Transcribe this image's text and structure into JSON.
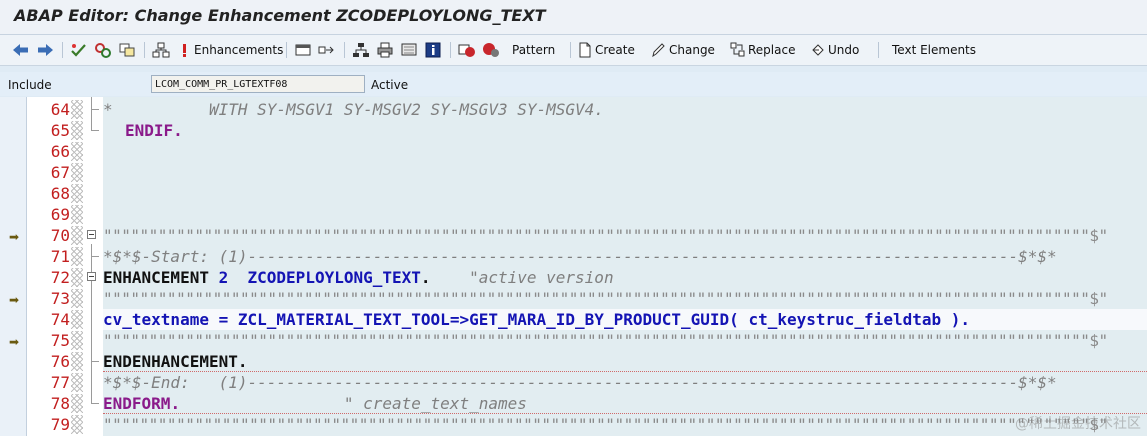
{
  "window": {
    "title": "ABAP Editor: Change Enhancement ZCODEPLOYLONG_TEXT"
  },
  "toolbar": {
    "back_icon": "arrow-left",
    "forward_icon": "arrow-right",
    "enhancements_label": "Enhancements",
    "pattern_label": "Pattern",
    "create_label": "Create",
    "change_label": "Change",
    "replace_label": "Replace",
    "undo_label": "Undo",
    "text_elements_label": "Text Elements"
  },
  "include": {
    "label": "Include",
    "value": "LCOM_COMM_PR_LGTEXTF08",
    "status": "Active"
  },
  "editor": {
    "lines": [
      {
        "num": "64",
        "code": "*          WITH SY-MSGV1 SY-MSGV2 SY-MSGV3 SY-MSGV4."
      },
      {
        "num": "65",
        "code": "ENDIF."
      },
      {
        "num": "66",
        "code": ""
      },
      {
        "num": "67",
        "code": ""
      },
      {
        "num": "68",
        "code": ""
      },
      {
        "num": "69",
        "code": ""
      },
      {
        "num": "70",
        "code": "\"\"\"\"\"\"\"\"\"\"\"\"\"\"\"\"\"\"\"\"\"\"\"\"\"\"\"\"\"\"\"\"\"\"\"\"\"\"\"\"\"\"\"\"\"\"\"\"\"\"\"\"\"\"\"\"\"\"\"\"\"\"\"\"\"\"\"\"\"\"\"\"\"\"\"\"\"\"\"\"\"\"\"\"\"\"\"\"\"\"\"\"\"\"\"\"\"\"\"\"\"\"\"\"\"\"\"\"$\""
      },
      {
        "num": "71",
        "code": "*$*$-Start: (1)--------------------------------------------------------------------------------$*$*"
      },
      {
        "num": "72",
        "kw1": "ENHANCEMENT",
        "num_lit": "2",
        "name": "ZCODEPLOYLONG_TEXT",
        "dot": ".",
        "comment": "\"active version"
      },
      {
        "num": "73",
        "code": "\"\"\"\"\"\"\"\"\"\"\"\"\"\"\"\"\"\"\"\"\"\"\"\"\"\"\"\"\"\"\"\"\"\"\"\"\"\"\"\"\"\"\"\"\"\"\"\"\"\"\"\"\"\"\"\"\"\"\"\"\"\"\"\"\"\"\"\"\"\"\"\"\"\"\"\"\"\"\"\"\"\"\"\"\"\"\"\"\"\"\"\"\"\"\"\"\"\"\"\"\"\"\"\"\"\"\"\"$\""
      },
      {
        "num": "74",
        "var1": "cv_textname",
        "eq": "=",
        "cls": "ZCL_MATERIAL_TEXT_TOOL",
        "arrow": "=>",
        "meth": "GET_MARA_ID_BY_PRODUCT_GUID",
        "open": "(",
        "arg": "ct_keystruc_fieldtab",
        "close": ")."
      },
      {
        "num": "75",
        "code": "\"\"\"\"\"\"\"\"\"\"\"\"\"\"\"\"\"\"\"\"\"\"\"\"\"\"\"\"\"\"\"\"\"\"\"\"\"\"\"\"\"\"\"\"\"\"\"\"\"\"\"\"\"\"\"\"\"\"\"\"\"\"\"\"\"\"\"\"\"\"\"\"\"\"\"\"\"\"\"\"\"\"\"\"\"\"\"\"\"\"\"\"\"\"\"\"\"\"\"\"\"\"\"\"\"\"\"\"$\""
      },
      {
        "num": "76",
        "kw": "ENDENHANCEMENT",
        "dot": "."
      },
      {
        "num": "77",
        "code": "*$*$-End:   (1)--------------------------------------------------------------------------------$*$*"
      },
      {
        "num": "78",
        "kw": "ENDFORM",
        "dot": ".",
        "comment": "\" create_text_names"
      },
      {
        "num": "79",
        "code": "\"\"\"\"\"\"\"\"\"\"\"\"\"\"\"\"\"\"\"\"\"\"\"\"\"\"\"\"\"\"\"\"\"\"\"\"\"\"\"\"\"\"\"\"\"\"\"\"\"\"\"\"\"\"\"\"\"\"\"\"\"\"\"\"\"\"\"\"\"\"\"\"\"\"\"\"\"\"\"\"\"\"\"\"\"\"\"\"\"\"\"\"\"\"\"\"\"\"\"\"\"\"\"\"\"\"\"\"$\""
      }
    ],
    "watermark": "@稀土掘金技术社区"
  }
}
